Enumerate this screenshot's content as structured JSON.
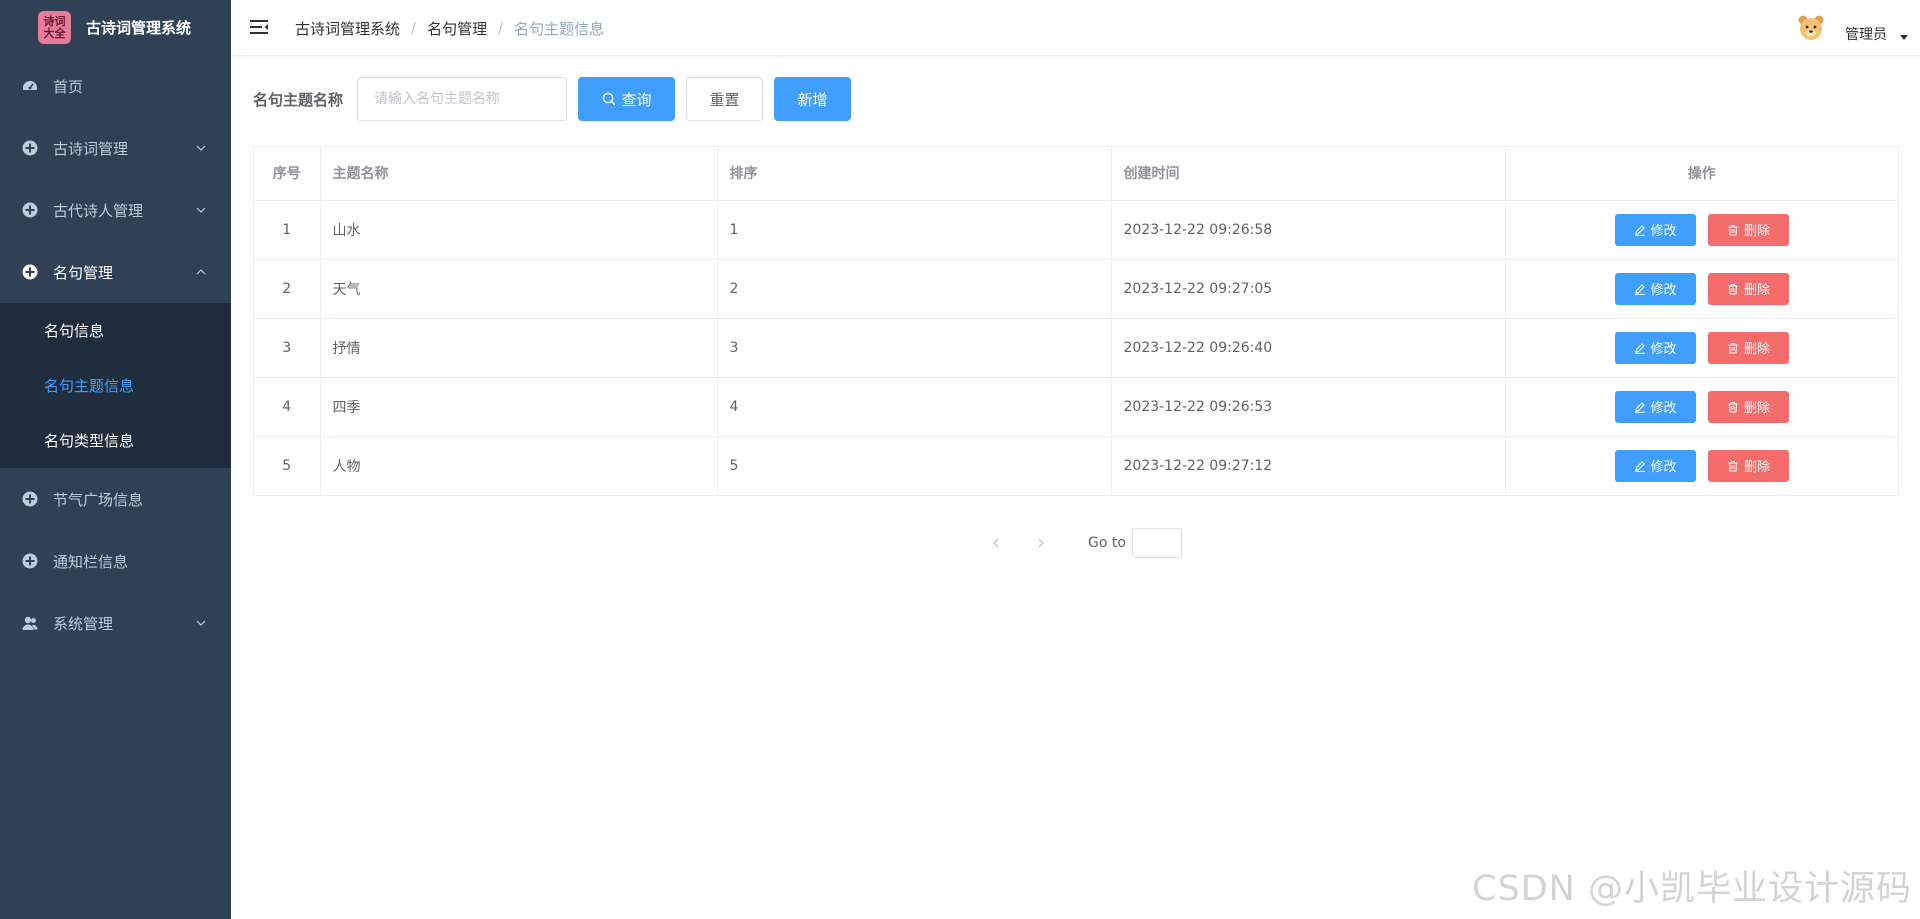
{
  "app": {
    "logo_text_line1": "诗词",
    "logo_text_line2": "大全",
    "title": "古诗词管理系统"
  },
  "sidebar": {
    "items": [
      {
        "label": "首页",
        "icon": "dashboard-icon",
        "has_children": false
      },
      {
        "label": "古诗词管理",
        "icon": "circle-plus-icon",
        "has_children": true,
        "expanded": false
      },
      {
        "label": "古代诗人管理",
        "icon": "circle-plus-icon",
        "has_children": true,
        "expanded": false
      },
      {
        "label": "名句管理",
        "icon": "circle-plus-icon",
        "has_children": true,
        "expanded": true,
        "children": [
          {
            "label": "名句信息",
            "active": false
          },
          {
            "label": "名句主题信息",
            "active": true
          },
          {
            "label": "名句类型信息",
            "active": false
          }
        ]
      },
      {
        "label": "节气广场信息",
        "icon": "circle-plus-icon",
        "has_children": false
      },
      {
        "label": "通知栏信息",
        "icon": "circle-plus-icon",
        "has_children": false
      },
      {
        "label": "系统管理",
        "icon": "user-group-icon",
        "has_children": true,
        "expanded": false
      }
    ]
  },
  "header": {
    "breadcrumb": [
      "古诗词管理系统",
      "名句管理",
      "名句主题信息"
    ],
    "user_name": "管理员",
    "avatar_icon": "bear-avatar-icon"
  },
  "search": {
    "label": "名句主题名称",
    "placeholder": "请输入名句主题名称",
    "value": "",
    "query_label": "查询",
    "reset_label": "重置",
    "add_label": "新增"
  },
  "table": {
    "headers": [
      "序号",
      "主题名称",
      "排序",
      "创建时间",
      "操作"
    ],
    "rows": [
      {
        "index": "1",
        "name": "山水",
        "sort": "1",
        "created": "2023-12-22 09:26:58"
      },
      {
        "index": "2",
        "name": "天气",
        "sort": "2",
        "created": "2023-12-22 09:27:05"
      },
      {
        "index": "3",
        "name": "抒情",
        "sort": "3",
        "created": "2023-12-22 09:26:40"
      },
      {
        "index": "4",
        "name": "四季",
        "sort": "4",
        "created": "2023-12-22 09:26:53"
      },
      {
        "index": "5",
        "name": "人物",
        "sort": "5",
        "created": "2023-12-22 09:27:12"
      }
    ],
    "edit_label": "修改",
    "delete_label": "删除"
  },
  "pagination": {
    "goto_label": "Go to",
    "goto_value": ""
  },
  "watermark": "CSDN @小凯毕业设计源码",
  "colors": {
    "sidebar_bg": "#304156",
    "submenu_bg": "#1f2d3d",
    "primary": "#409eff",
    "danger": "#f56c6c"
  }
}
